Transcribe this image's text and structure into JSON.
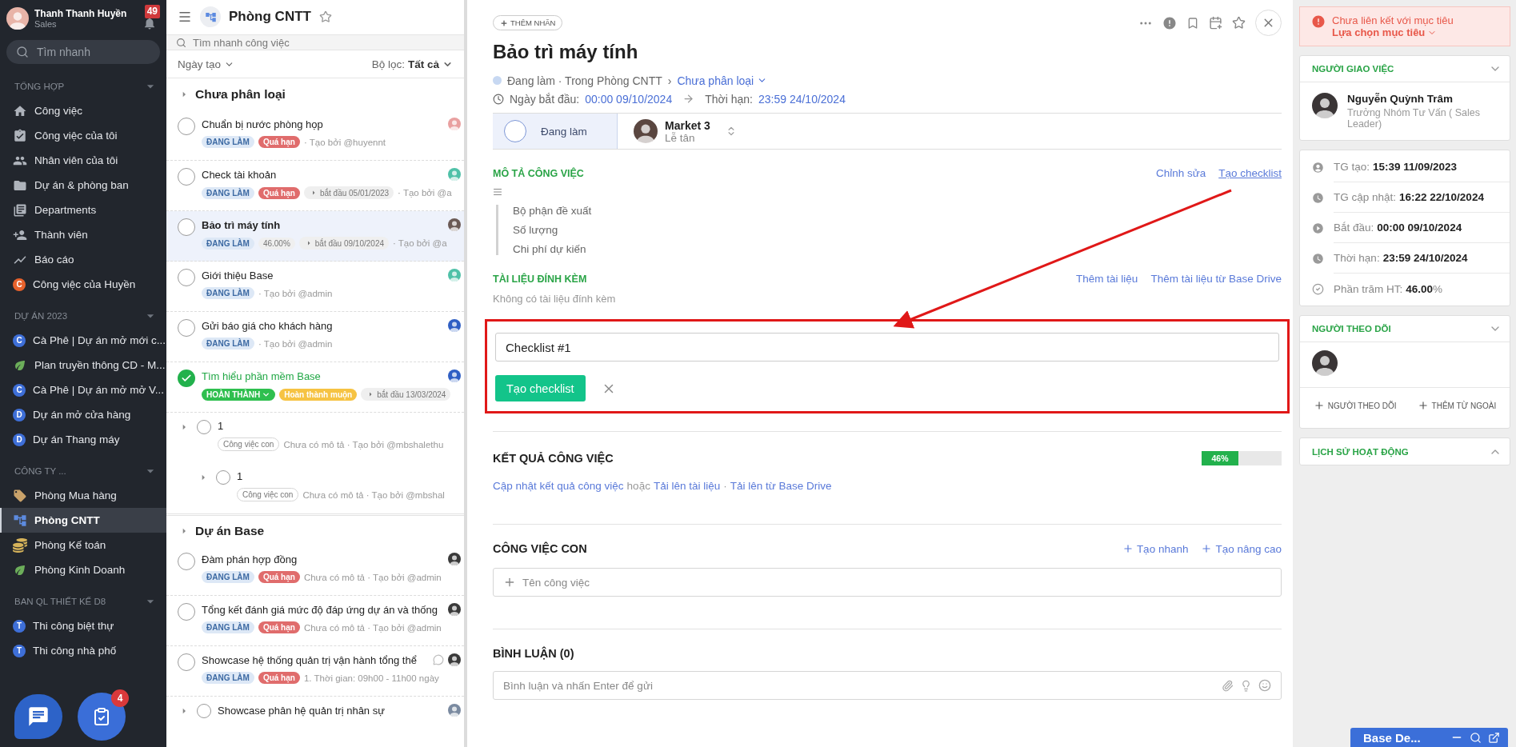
{
  "sidebar": {
    "user": {
      "name": "Thanh Thanh Huyền",
      "role": "Sales",
      "notifications": "49"
    },
    "search": {
      "placeholder": "Tìm nhanh"
    },
    "sections": [
      {
        "title": "TỔNG HỢP",
        "items": [
          {
            "kind": "home",
            "label": "Công việc",
            "selected": false
          },
          {
            "kind": "task",
            "label": "Công việc của tôi",
            "selected": false
          },
          {
            "kind": "people",
            "label": "Nhân viên của tôi",
            "selected": false
          },
          {
            "kind": "folder",
            "label": "Dự án & phòng ban",
            "selected": false
          },
          {
            "kind": "book",
            "label": "Departments",
            "selected": false
          },
          {
            "kind": "member",
            "label": "Thành viên",
            "selected": false
          },
          {
            "kind": "chart",
            "label": "Báo cáo",
            "selected": false
          },
          {
            "kind": "letter",
            "letter": "C",
            "color": "#e8622c",
            "label": "Công việc của Huyền",
            "selected": false
          }
        ]
      },
      {
        "title": "DỰ ÁN 2023",
        "items": [
          {
            "kind": "letter",
            "letter": "C",
            "color": "#3e6fd8",
            "label": "Cà Phê | Dự án mở mới c...",
            "selected": false
          },
          {
            "kind": "plant",
            "label": "Plan truyền thông CD - M...",
            "selected": false
          },
          {
            "kind": "letter",
            "letter": "C",
            "color": "#3e6fd8",
            "label": "Cà Phê | Dự án mở mở V...",
            "selected": false
          },
          {
            "kind": "letter",
            "letter": "D",
            "color": "#3e6fd8",
            "label": "Dự án mở cửa hàng",
            "selected": false
          },
          {
            "kind": "letter",
            "letter": "D",
            "color": "#3e6fd8",
            "label": "Dự án Thang máy",
            "selected": false
          }
        ]
      },
      {
        "title": "CÔNG TY ...",
        "items": [
          {
            "kind": "tag",
            "label": "Phòng Mua hàng",
            "selected": false
          },
          {
            "kind": "tree",
            "label": "Phòng CNTT",
            "selected": true
          },
          {
            "kind": "coins",
            "label": "Phòng Kế toán",
            "selected": false
          },
          {
            "kind": "plant",
            "label": "Phòng Kinh Doanh",
            "selected": false
          }
        ]
      },
      {
        "title": "BAN QL THIẾT KẾ D8",
        "items": [
          {
            "kind": "letter",
            "letter": "T",
            "color": "#3e6fd8",
            "label": "Thi công biệt thự",
            "selected": false
          },
          {
            "kind": "letter",
            "letter": "T",
            "color": "#3e6fd8",
            "label": "Thi công nhà phố",
            "selected": false
          }
        ]
      }
    ]
  },
  "task_list": {
    "title": "Phòng CNTT",
    "search": {
      "placeholder": "Tìm nhanh công việc"
    },
    "sort": "Ngày tạo",
    "filter_label": "Bộ lọc:",
    "filter_value": "Tất cả",
    "groups": [
      {
        "title": "Chưa phân loại",
        "tasks": [
          {
            "title": "Chuẩn bị nước phòng họp",
            "done": false,
            "selected": false,
            "color": "#e9a0a0",
            "tags": [
              {
                "kind": "status",
                "text": "ĐANG LÀM"
              },
              {
                "kind": "overdue",
                "text": "Quá hạn"
              }
            ],
            "meta": "· Tạo bởi @huyennt"
          },
          {
            "title": "Check tài khoản",
            "done": false,
            "selected": false,
            "color": "#4fc1a8",
            "tags": [
              {
                "kind": "status",
                "text": "ĐANG LÀM"
              },
              {
                "kind": "overdue",
                "text": "Quá hạn"
              },
              {
                "kind": "start",
                "text": "bắt đầu 05/01/2023"
              }
            ],
            "meta": "· Tạo bởi @a"
          },
          {
            "title": "Bảo trì máy tính",
            "done": false,
            "selected": true,
            "color": "#6b5a55",
            "tags": [
              {
                "kind": "status",
                "text": "ĐANG LÀM"
              },
              {
                "kind": "percent",
                "text": "46.00%"
              },
              {
                "kind": "start",
                "text": "bắt đầu 09/10/2024"
              }
            ],
            "meta": "· Tạo bởi @a"
          },
          {
            "title": "Giới thiệu Base",
            "done": false,
            "selected": false,
            "color": "#4fc1a8",
            "tags": [
              {
                "kind": "status",
                "text": "ĐANG LÀM"
              }
            ],
            "meta": "· Tạo bởi @admin"
          },
          {
            "title": "Gửi báo giá cho khách hàng",
            "done": false,
            "selected": false,
            "color": "#2f5fc4",
            "tags": [
              {
                "kind": "status",
                "text": "ĐANG LÀM"
              }
            ],
            "meta": "· Tạo bởi @admin"
          },
          {
            "title": "Tìm hiểu phần mềm Base",
            "done": true,
            "selected": false,
            "color": "#2f5fc4",
            "tags": [
              {
                "kind": "done",
                "text": "HOÀN THÀNH"
              },
              {
                "kind": "late",
                "text": "Hoàn thành muộn"
              },
              {
                "kind": "start",
                "text": "bắt đầu 13/03/2024"
              }
            ],
            "children": [
              {
                "title": "1",
                "done": false,
                "selected": false,
                "tags": [
                  {
                    "kind": "subtask",
                    "text": "Công việc con"
                  }
                ],
                "meta": "Chưa có mô tả · Tạo bởi @mbshalethu",
                "children": [
                  {
                    "title": "1",
                    "done": false,
                    "selected": false,
                    "tags": [
                      {
                        "kind": "subtask",
                        "text": "Công việc con"
                      }
                    ],
                    "meta": "Chưa có mô tả · Tạo bởi @mbshal"
                  }
                ]
              }
            ]
          }
        ]
      },
      {
        "title": "Dự án Base",
        "tasks": [
          {
            "title": "Đàm phán hợp đồng",
            "done": false,
            "selected": false,
            "color": "#3a3a3a",
            "tags": [
              {
                "kind": "status",
                "text": "ĐANG LÀM"
              },
              {
                "kind": "overdue",
                "text": "Quá hạn"
              }
            ],
            "meta": "Chưa có mô tả · Tạo bởi @admin"
          },
          {
            "title": "Tổng kết đánh giá mức độ đáp ứng dự án và thống",
            "done": false,
            "selected": false,
            "color": "#3a3a3a",
            "tags": [
              {
                "kind": "status",
                "text": "ĐANG LÀM"
              },
              {
                "kind": "overdue",
                "text": "Quá hạn"
              }
            ],
            "meta": "Chưa có mô tả · Tạo bởi @admin"
          },
          {
            "title": "Showcase hệ thống quản trị vận hành tổng thể",
            "done": false,
            "selected": false,
            "comments": true,
            "color": "#3a3a3a",
            "tags": [
              {
                "kind": "status",
                "text": "ĐANG LÀM"
              },
              {
                "kind": "overdue",
                "text": "Quá hạn"
              }
            ],
            "meta": "1. Thời gian: 09h00 - 11h00 ngày",
            "children": [
              {
                "title": "Showcase phân hệ quản trị nhân sự",
                "done": false,
                "selected": false,
                "color": "#7a8aa0"
              }
            ]
          }
        ]
      }
    ]
  },
  "task_detail": {
    "add_label": "THÊM NHÃN",
    "title": "Bảo trì máy tính",
    "status_line": "Đang làm · Trong Phòng CNTT",
    "crumb_separator": "›",
    "category": "Chưa phân loại",
    "start_label": "Ngày bắt đầu:",
    "start": "00:00 09/10/2024",
    "deadline_label": "Thời hạn:",
    "deadline": "23:59 24/10/2024",
    "status_button": "Đang làm",
    "assignee": {
      "name": "Market 3",
      "role": "Lễ tân"
    },
    "description": {
      "title": "MÔ TẢ CÔNG VIỆC",
      "actions": [
        "Chỉnh sửa",
        "Tạo checklist"
      ],
      "lines": [
        "Bộ phận đề xuất",
        "Số lượng",
        "Chi phí dự kiến"
      ]
    },
    "attachments": {
      "title": "TÀI LIỆU ĐÍNH KÈM",
      "actions": [
        "Thêm tài liệu",
        "Thêm tài liệu từ Base Drive"
      ],
      "empty": "Không có tài liệu đính kèm"
    },
    "checklist_form": {
      "value": "Checklist #1",
      "submit": "Tạo checklist",
      "highlighted": true
    },
    "result": {
      "title": "KẾT QUẢ CÔNG VIỆC",
      "level": 0.46,
      "reading": "46%",
      "update_link": "Cập nhật kết quả công việc",
      "or": "hoặc",
      "upload_link": "Tải lên tài liệu",
      "separator": "·",
      "drive_link": "Tải lên từ Base Drive"
    },
    "subtasks": {
      "title": "CÔNG VIỆC CON",
      "actions": [
        "Tạo nhanh",
        "Tạo nâng cao"
      ],
      "placeholder": "Tên công việc"
    },
    "comments": {
      "title": "BÌNH LUẬN (0)",
      "placeholder": "Bình luận và nhấn Enter để gửi"
    }
  },
  "right_panel": {
    "goal_alert": {
      "text": "Chưa liên kết với mục tiêu",
      "action": "Lựa chọn mục tiêu"
    },
    "assigner": {
      "title": "NGƯỜI GIAO VIỆC",
      "name": "Nguyễn Quỳnh Trâm",
      "role": "Trưởng Nhóm Tư Vấn ( Sales Leader)"
    },
    "info": [
      {
        "kind": "created",
        "label": "TG tạo:",
        "value": "15:39 11/09/2023"
      },
      {
        "kind": "updated",
        "label": "TG cập nhật:",
        "value": "16:22 22/10/2024"
      },
      {
        "kind": "start",
        "label": "Bắt đầu:",
        "value": "00:00 09/10/2024"
      },
      {
        "kind": "deadline",
        "label": "Thời hạn:",
        "value": "23:59 24/10/2024"
      },
      {
        "kind": "percent",
        "label": "Phần trăm HT:",
        "value": "46.00",
        "unit": "%"
      }
    ],
    "followers": {
      "title": "NGƯỜI THEO DÕI",
      "actions": [
        "NGƯỜI THEO DÕI",
        "THÊM TỪ NGOÀI"
      ]
    },
    "history": {
      "title": "LỊCH SỬ HOẠT ĐỘNG"
    }
  },
  "task_fab": {
    "badge": "4"
  },
  "chat_bar": {
    "title": "Base De..."
  }
}
